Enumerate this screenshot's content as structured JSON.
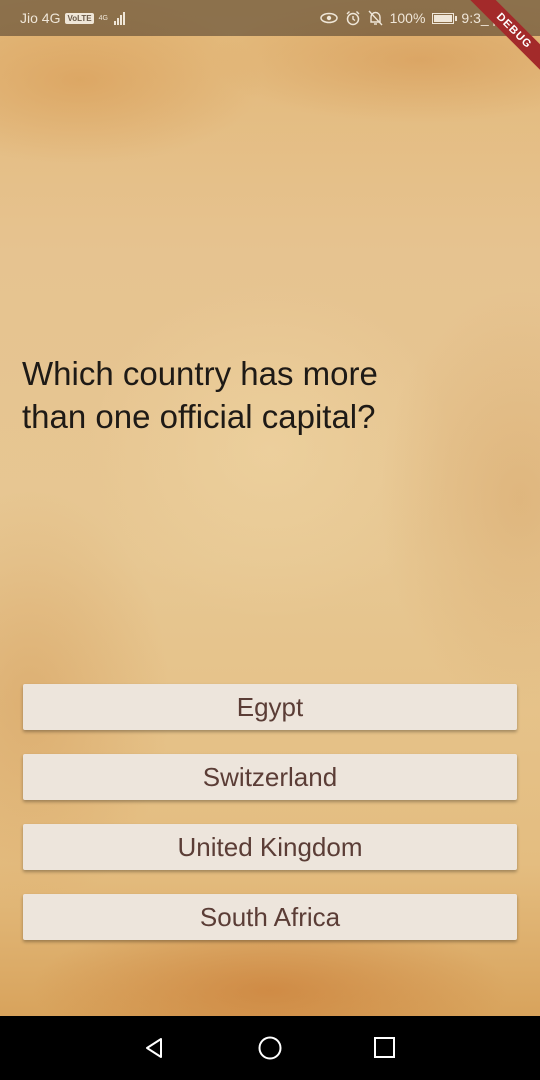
{
  "status_bar": {
    "carrier": "Jio 4G",
    "volte": "VoLTE",
    "network": "4G",
    "battery": "100%",
    "time": "9:3_ pm"
  },
  "debug_banner": "DEBUG",
  "question": " Which country has more\nthan one official capital?",
  "answers": [
    "Egypt",
    "Switzerland",
    "United Kingdom",
    "South Africa"
  ],
  "nav_bar": {
    "icons": [
      "back-icon",
      "home-icon",
      "recents-icon"
    ]
  },
  "colors": {
    "button_bg": "#ede5dc",
    "button_text": "#5b3d36",
    "question_text": "#1e1a16",
    "debug_banner": "#a32a2a"
  }
}
